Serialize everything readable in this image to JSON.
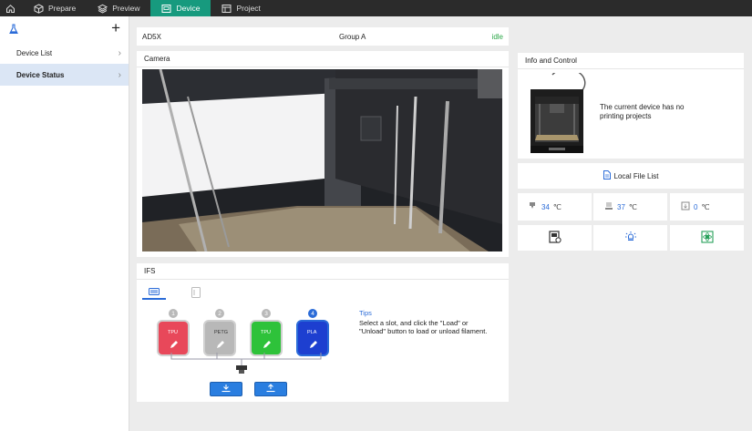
{
  "topbar": {
    "tabs": [
      {
        "label": "Prepare",
        "icon": "cube-icon"
      },
      {
        "label": "Preview",
        "icon": "layers-icon"
      },
      {
        "label": "Device",
        "icon": "device-icon"
      },
      {
        "label": "Project",
        "icon": "project-icon"
      }
    ],
    "active_tab": "Device",
    "accent_color": "#179a7e"
  },
  "sidebar": {
    "items": [
      {
        "label": "Device List"
      },
      {
        "label": "Device Status"
      }
    ],
    "active_item": "Device Status"
  },
  "device": {
    "name": "AD5X",
    "group": "Group A",
    "status": "idle",
    "status_color": "#2fa84a"
  },
  "camera": {
    "title": "Camera"
  },
  "ifs": {
    "title": "IFS",
    "slots": [
      {
        "number": "1",
        "material": "TPU",
        "color": "#e8485a"
      },
      {
        "number": "2",
        "material": "PETG",
        "color": "#b8b8b8"
      },
      {
        "number": "3",
        "material": "TPU",
        "color": "#2ec23a"
      },
      {
        "number": "4",
        "material": "PLA",
        "color": "#1d3fd0"
      }
    ],
    "active_slot": "4",
    "tips_title": "Tips",
    "tips_text": "Select a slot, and click the \"Load\" or \"Unload\" button to load or unload filament."
  },
  "info_control": {
    "title": "Info and Control",
    "message": "The current device has no printing projects"
  },
  "local_file_list": {
    "label": "Local File List"
  },
  "temperatures": [
    {
      "name": "nozzle",
      "icon": "nozzle-icon",
      "value": "34",
      "unit": "℃"
    },
    {
      "name": "bed",
      "icon": "bed-icon",
      "value": "37",
      "unit": "℃"
    },
    {
      "name": "chamber",
      "icon": "chamber-icon",
      "value": "0",
      "unit": "℃"
    }
  ],
  "controls": [
    {
      "name": "camera-control",
      "icon": "camera-control-icon"
    },
    {
      "name": "light-control",
      "icon": "light-icon"
    },
    {
      "name": "filter-control",
      "icon": "filter-icon"
    }
  ]
}
